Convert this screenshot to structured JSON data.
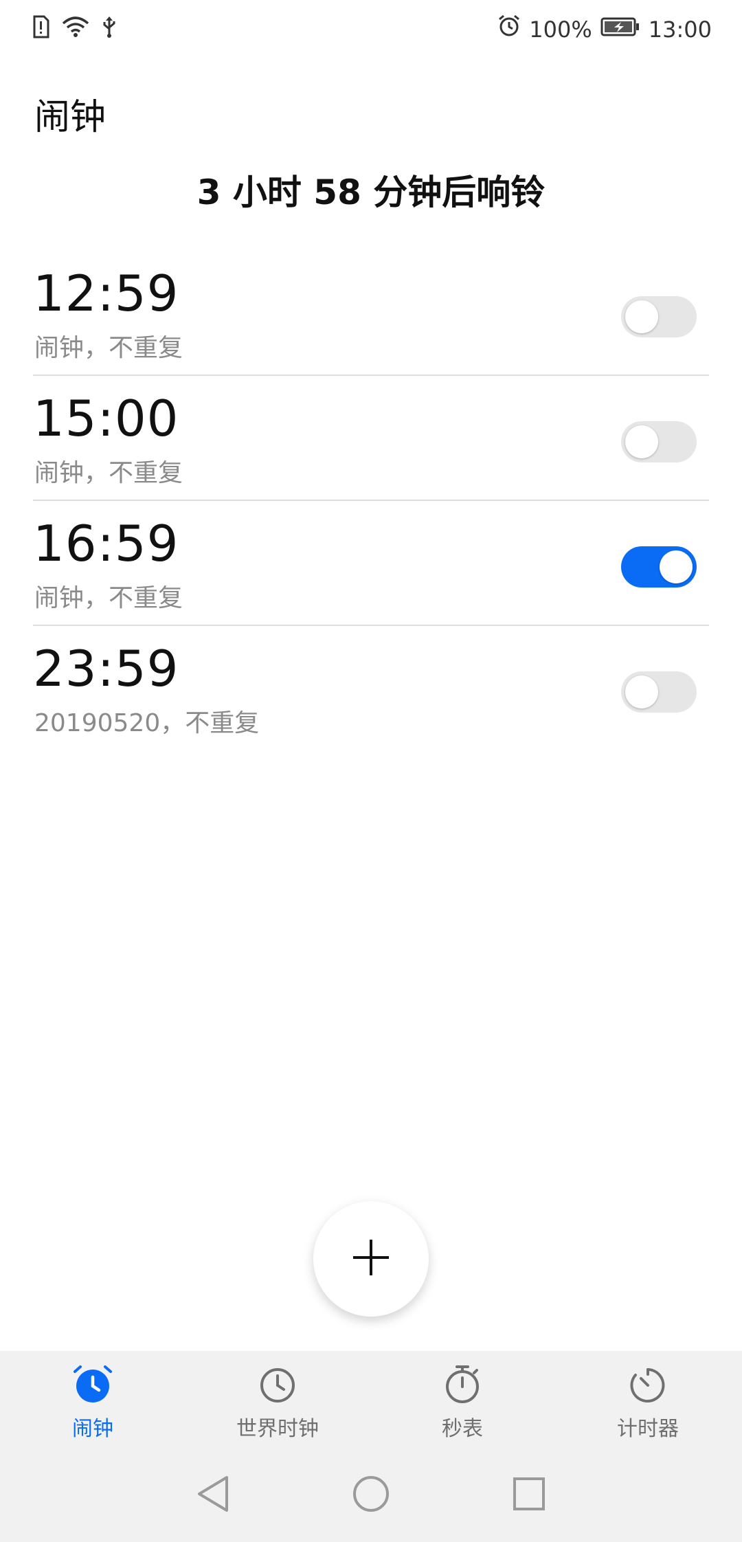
{
  "status_bar": {
    "battery_percent": "100%",
    "time": "13:00"
  },
  "header": {
    "title": "闹钟",
    "next_alarm": "3 小时 58 分钟后响铃"
  },
  "alarms": [
    {
      "time": "12:59",
      "desc": "闹钟，不重复",
      "enabled": false
    },
    {
      "time": "15:00",
      "desc": "闹钟，不重复",
      "enabled": false
    },
    {
      "time": "16:59",
      "desc": "闹钟，不重复",
      "enabled": true
    },
    {
      "time": "23:59",
      "desc": "20190520，不重复",
      "enabled": false
    }
  ],
  "bottom_nav": {
    "tabs": [
      {
        "label": "闹钟",
        "icon": "alarm-clock-icon",
        "active": true
      },
      {
        "label": "世界时钟",
        "icon": "clock-icon",
        "active": false
      },
      {
        "label": "秒表",
        "icon": "stopwatch-icon",
        "active": false
      },
      {
        "label": "计时器",
        "icon": "timer-icon",
        "active": false
      }
    ]
  },
  "colors": {
    "accent": "#0a6cf5",
    "toggle_off": "#e6e6e6",
    "secondary_text": "#8a8a8a",
    "nav_background": "#f1f1f1"
  }
}
